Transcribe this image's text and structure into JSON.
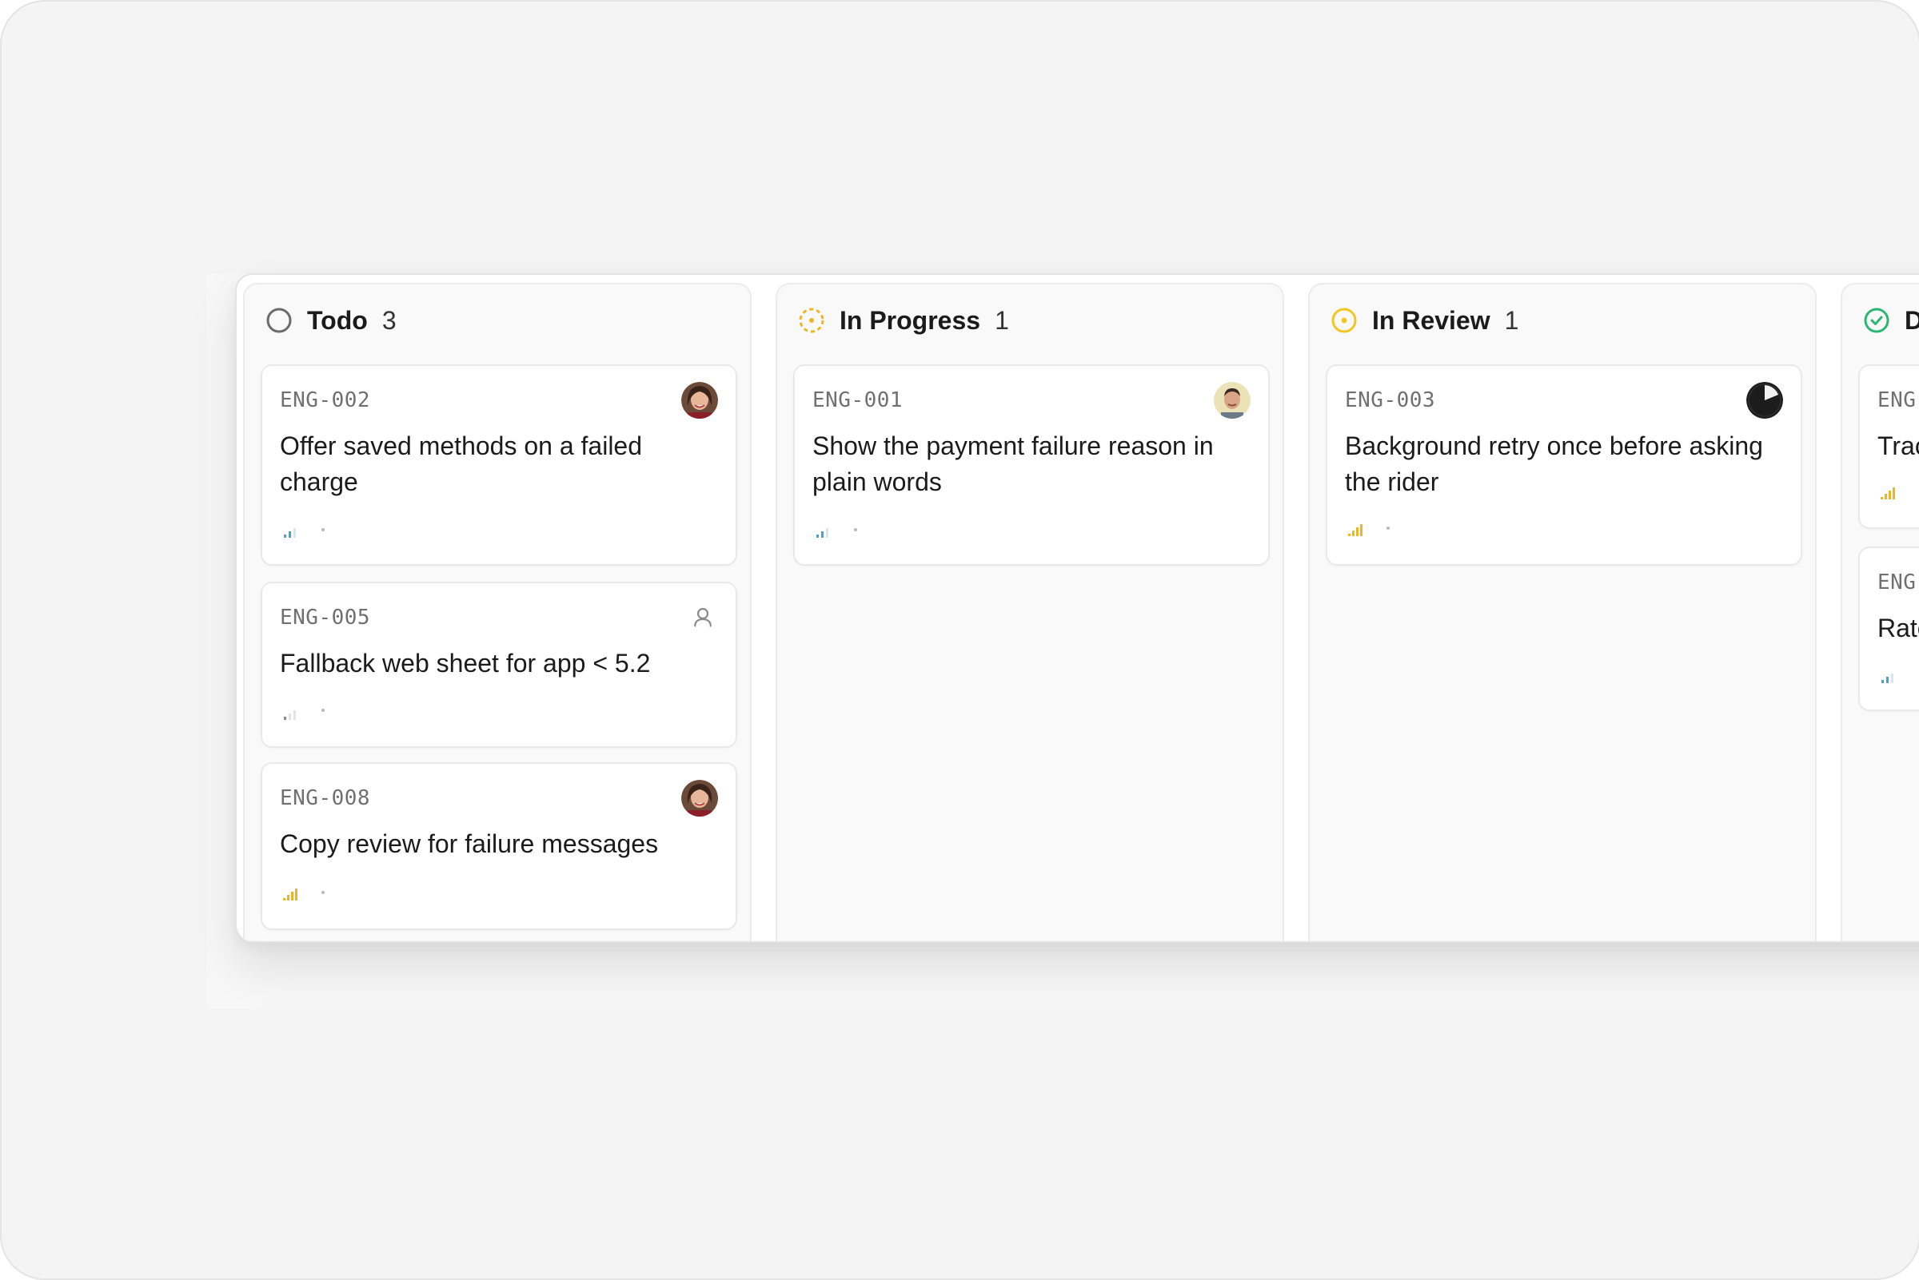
{
  "colors": {
    "todo": "#6b6b6b",
    "in_progress": "#f0b429",
    "in_review": "#f3c623",
    "done": "#2bb673",
    "priority_blue": "#3aa7d8",
    "priority_yellow": "#f0b429",
    "priority_gray": "#8a8a8a"
  },
  "columns": [
    {
      "title": "Todo",
      "count": "3",
      "status_icon": "todo-circle-icon",
      "cards": [
        {
          "id": "ENG-002",
          "title": "Offer saved methods on a failed charge",
          "assignee": "avatar-woman-1",
          "priority": "medium"
        },
        {
          "id": "ENG-005",
          "title": "Fallback web sheet for app < 5.2",
          "assignee": "unassigned-user-icon",
          "priority": "low"
        },
        {
          "id": "ENG-008",
          "title": "Copy review for failure messages",
          "assignee": "avatar-woman-1",
          "priority": "high"
        }
      ]
    },
    {
      "title": "In Progress",
      "count": "1",
      "status_icon": "in-progress-dashed-circle-icon",
      "cards": [
        {
          "id": "ENG-001",
          "title": "Show the payment failure reason in plain words",
          "assignee": "avatar-man-1",
          "priority": "medium"
        }
      ]
    },
    {
      "title": "In Review",
      "count": "1",
      "status_icon": "in-review-circle-icon",
      "cards": [
        {
          "id": "ENG-003",
          "title": "Background retry once before asking the rider",
          "assignee": "avatar-dark",
          "priority": "high"
        }
      ]
    },
    {
      "title": "D",
      "count": "",
      "status_icon": "done-check-circle-icon",
      "cards": [
        {
          "id": "ENG-",
          "title": "Trac",
          "priority": "high"
        },
        {
          "id": "ENG-",
          "title": "Rate",
          "priority": "medium"
        }
      ]
    }
  ]
}
